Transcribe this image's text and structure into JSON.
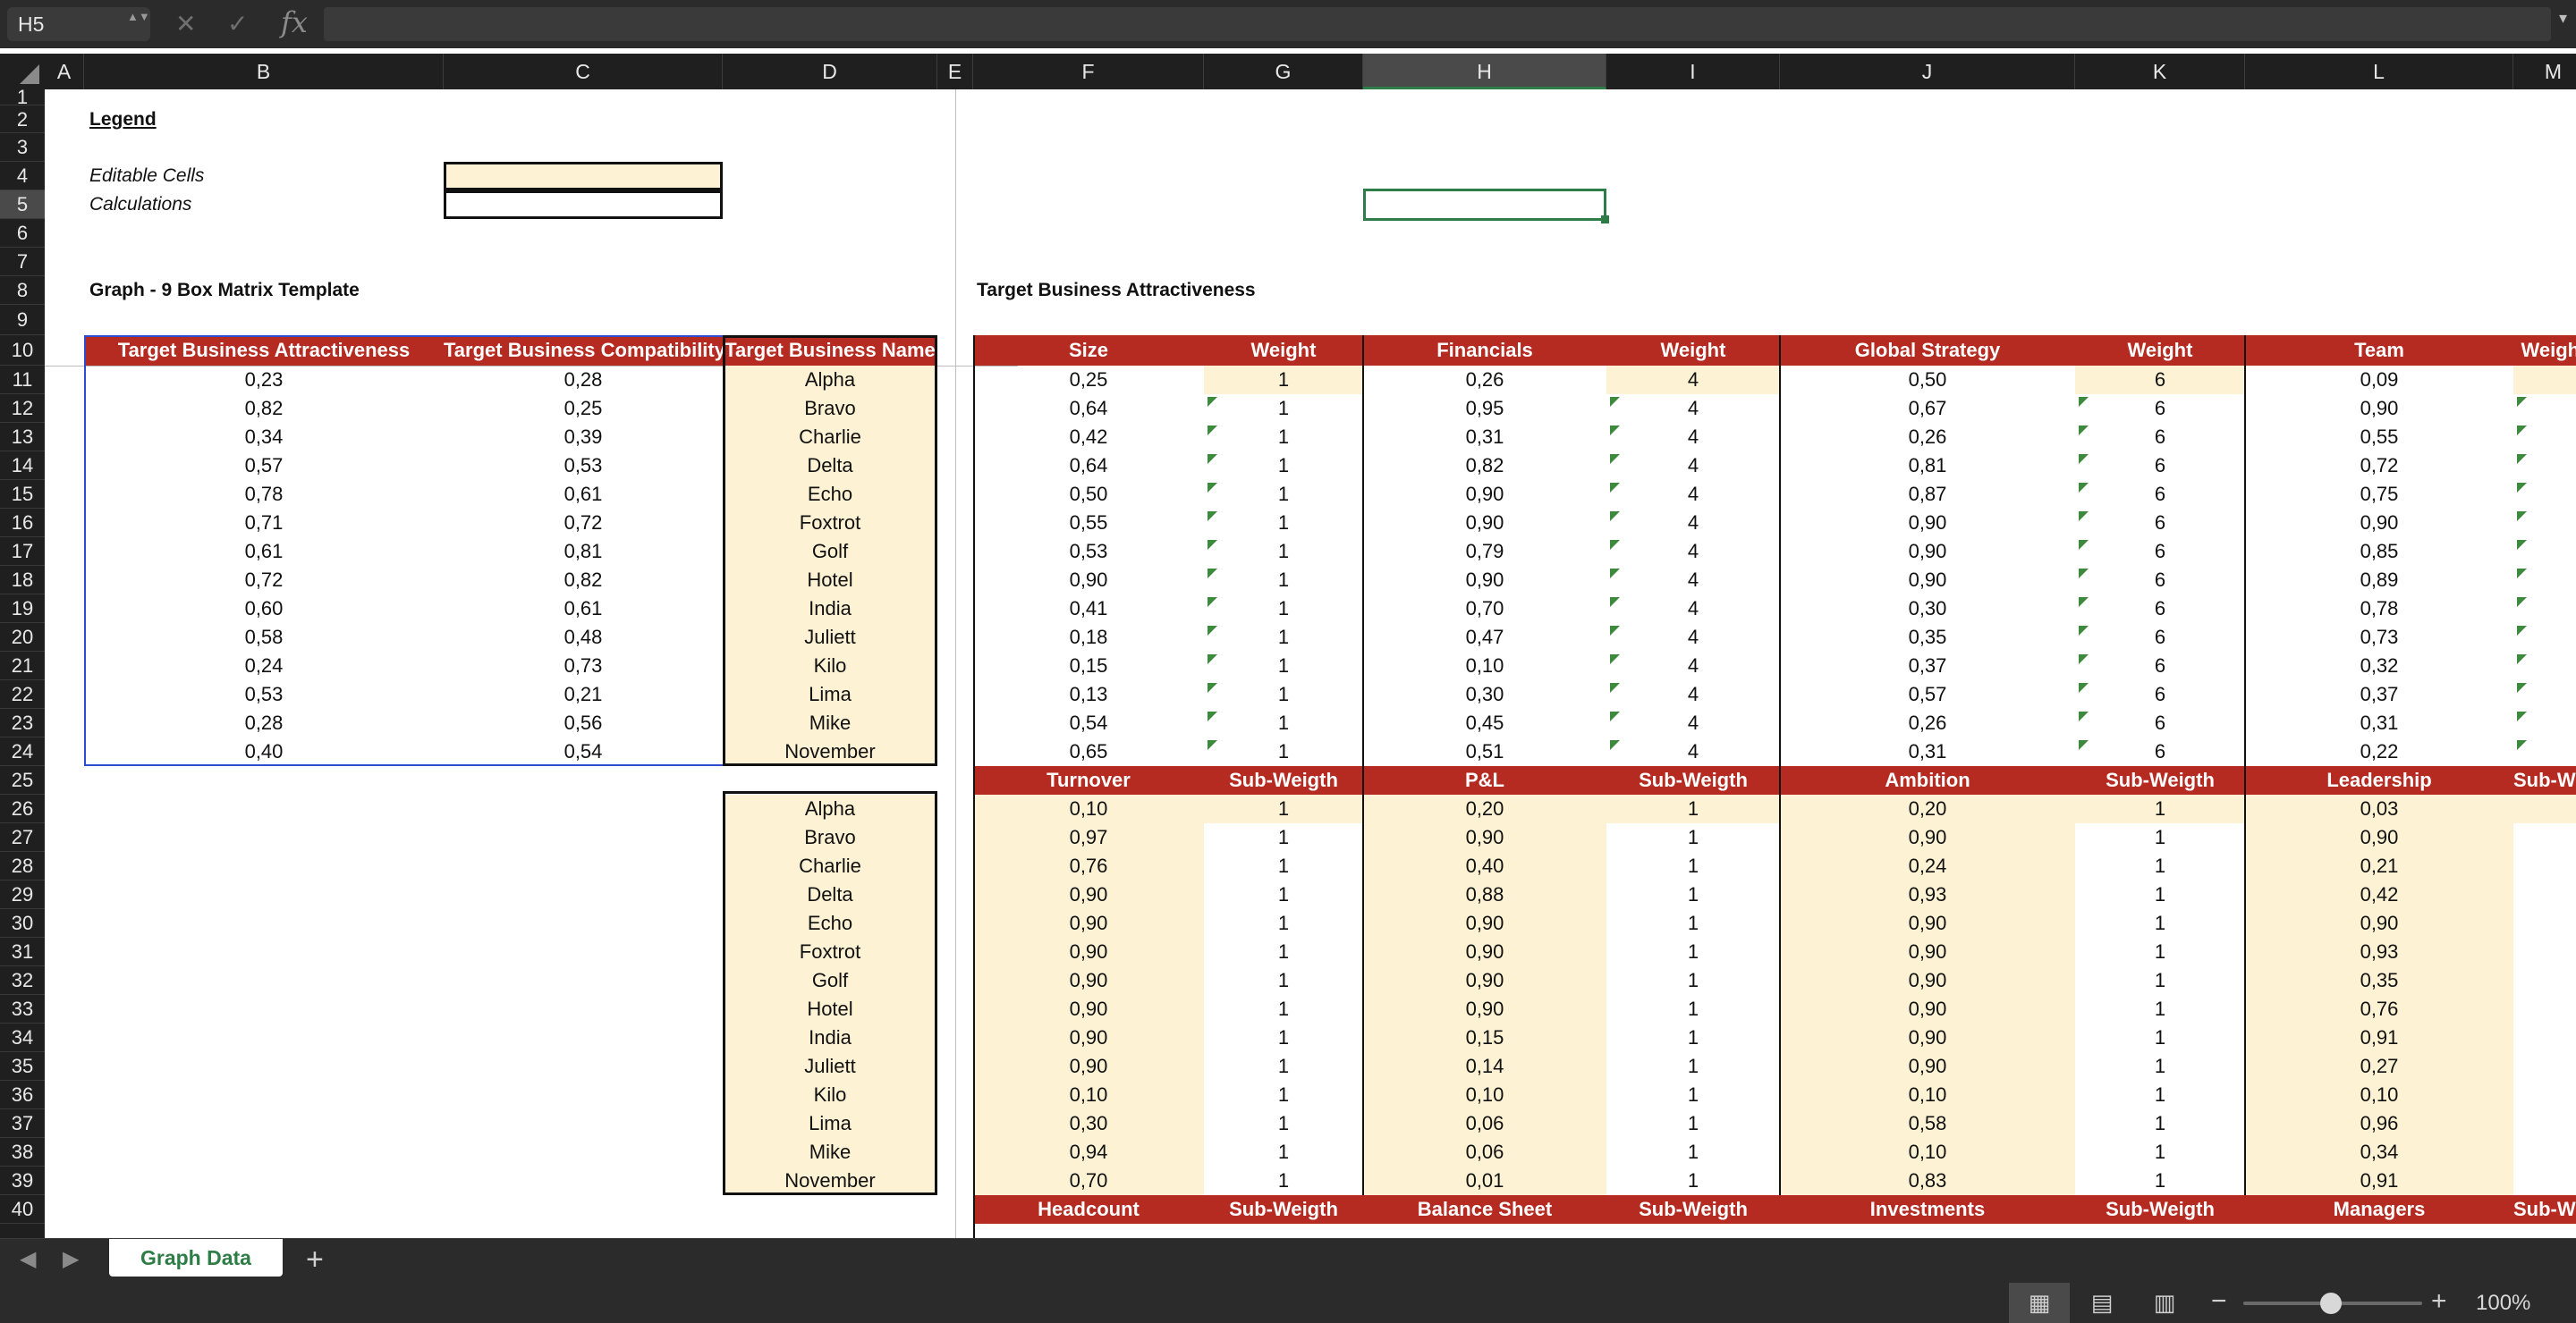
{
  "formula_bar": {
    "cell_ref": "H5",
    "stepper": "▲▼",
    "cancel": "✕",
    "enter": "✓",
    "fx": "fx",
    "value": "",
    "chevron": "▾"
  },
  "columns": [
    "A",
    "B",
    "C",
    "D",
    "E",
    "F",
    "G",
    "H",
    "I",
    "J",
    "K",
    "L",
    "M"
  ],
  "selected_column": "H",
  "rows": [
    "1",
    "2",
    "3",
    "4",
    "5",
    "6",
    "7",
    "8",
    "9",
    "10",
    "11",
    "12",
    "13",
    "14",
    "15",
    "16",
    "17",
    "18",
    "19",
    "20",
    "21",
    "22",
    "23",
    "24",
    "25",
    "26",
    "27",
    "28",
    "29",
    "30",
    "31",
    "32",
    "33",
    "34",
    "35",
    "36",
    "37",
    "38",
    "39",
    "40"
  ],
  "selected_row": "5",
  "legend": {
    "title": "Legend",
    "editable": "Editable Cells",
    "calculations": "Calculations"
  },
  "section_titles": {
    "graph": "Graph - 9 Box Matrix Template",
    "attractiveness": "Target Business Attractiveness"
  },
  "left_table": {
    "headers": [
      "Target Business Attractiveness",
      "Target Business Compatibility",
      "Target Business Name"
    ],
    "rows": [
      [
        "0,23",
        "0,28",
        "Alpha"
      ],
      [
        "0,82",
        "0,25",
        "Bravo"
      ],
      [
        "0,34",
        "0,39",
        "Charlie"
      ],
      [
        "0,57",
        "0,53",
        "Delta"
      ],
      [
        "0,78",
        "0,61",
        "Echo"
      ],
      [
        "0,71",
        "0,72",
        "Foxtrot"
      ],
      [
        "0,61",
        "0,81",
        "Golf"
      ],
      [
        "0,72",
        "0,82",
        "Hotel"
      ],
      [
        "0,60",
        "0,61",
        "India"
      ],
      [
        "0,58",
        "0,48",
        "Juliett"
      ],
      [
        "0,24",
        "0,73",
        "Kilo"
      ],
      [
        "0,53",
        "0,21",
        "Lima"
      ],
      [
        "0,28",
        "0,56",
        "Mike"
      ],
      [
        "0,40",
        "0,54",
        "November"
      ]
    ]
  },
  "names_list": [
    "Alpha",
    "Bravo",
    "Charlie",
    "Delta",
    "Echo",
    "Foxtrot",
    "Golf",
    "Hotel",
    "India",
    "Juliett",
    "Kilo",
    "Lima",
    "Mike",
    "November"
  ],
  "block1": {
    "headers": [
      "Size",
      "Weight",
      "Financials",
      "Weight",
      "Global Strategy",
      "Weight",
      "Team",
      "Weight"
    ],
    "rows": [
      [
        "0,25",
        "1",
        "0,26",
        "4",
        "0,50",
        "6",
        "0,09"
      ],
      [
        "0,64",
        "1",
        "0,95",
        "4",
        "0,67",
        "6",
        "0,90"
      ],
      [
        "0,42",
        "1",
        "0,31",
        "4",
        "0,26",
        "6",
        "0,55"
      ],
      [
        "0,64",
        "1",
        "0,82",
        "4",
        "0,81",
        "6",
        "0,72"
      ],
      [
        "0,50",
        "1",
        "0,90",
        "4",
        "0,87",
        "6",
        "0,75"
      ],
      [
        "0,55",
        "1",
        "0,90",
        "4",
        "0,90",
        "6",
        "0,90"
      ],
      [
        "0,53",
        "1",
        "0,79",
        "4",
        "0,90",
        "6",
        "0,85"
      ],
      [
        "0,90",
        "1",
        "0,90",
        "4",
        "0,90",
        "6",
        "0,89"
      ],
      [
        "0,41",
        "1",
        "0,70",
        "4",
        "0,30",
        "6",
        "0,78"
      ],
      [
        "0,18",
        "1",
        "0,47",
        "4",
        "0,35",
        "6",
        "0,73"
      ],
      [
        "0,15",
        "1",
        "0,10",
        "4",
        "0,37",
        "6",
        "0,32"
      ],
      [
        "0,13",
        "1",
        "0,30",
        "4",
        "0,57",
        "6",
        "0,37"
      ],
      [
        "0,54",
        "1",
        "0,45",
        "4",
        "0,26",
        "6",
        "0,31"
      ],
      [
        "0,65",
        "1",
        "0,51",
        "4",
        "0,31",
        "6",
        "0,22"
      ]
    ]
  },
  "block2": {
    "headers": [
      "Turnover",
      "Sub-Weigth",
      "P&L",
      "Sub-Weigth",
      "Ambition",
      "Sub-Weigth",
      "Leadership",
      "Sub-Weigth"
    ],
    "rows": [
      [
        "0,10",
        "1",
        "0,20",
        "1",
        "0,20",
        "1",
        "0,03"
      ],
      [
        "0,97",
        "1",
        "0,90",
        "1",
        "0,90",
        "1",
        "0,90"
      ],
      [
        "0,76",
        "1",
        "0,40",
        "1",
        "0,24",
        "1",
        "0,21"
      ],
      [
        "0,90",
        "1",
        "0,88",
        "1",
        "0,93",
        "1",
        "0,42"
      ],
      [
        "0,90",
        "1",
        "0,90",
        "1",
        "0,90",
        "1",
        "0,90"
      ],
      [
        "0,90",
        "1",
        "0,90",
        "1",
        "0,90",
        "1",
        "0,93"
      ],
      [
        "0,90",
        "1",
        "0,90",
        "1",
        "0,90",
        "1",
        "0,35"
      ],
      [
        "0,90",
        "1",
        "0,90",
        "1",
        "0,90",
        "1",
        "0,76"
      ],
      [
        "0,90",
        "1",
        "0,15",
        "1",
        "0,90",
        "1",
        "0,91"
      ],
      [
        "0,90",
        "1",
        "0,14",
        "1",
        "0,90",
        "1",
        "0,27"
      ],
      [
        "0,10",
        "1",
        "0,10",
        "1",
        "0,10",
        "1",
        "0,10"
      ],
      [
        "0,30",
        "1",
        "0,06",
        "1",
        "0,58",
        "1",
        "0,96"
      ],
      [
        "0,94",
        "1",
        "0,06",
        "1",
        "0,10",
        "1",
        "0,34"
      ],
      [
        "0,70",
        "1",
        "0,01",
        "1",
        "0,83",
        "1",
        "0,91"
      ]
    ]
  },
  "block3_headers": [
    "Headcount",
    "Sub-Weigth",
    "Balance Sheet",
    "Sub-Weigth",
    "Investments",
    "Sub-Weigth",
    "Managers",
    "Sub-Weigth"
  ],
  "sheet_tabs": {
    "active": "Graph Data",
    "add": "+",
    "prev": "◀",
    "next": "▶"
  },
  "status": {
    "zoom": "100%",
    "minus": "−",
    "plus": "+",
    "views": [
      "▦",
      "▤",
      "▥"
    ]
  },
  "colors": {
    "header_red": "#b52a21",
    "cream": "#fdf2d3",
    "excel_green": "#2e7d46"
  }
}
